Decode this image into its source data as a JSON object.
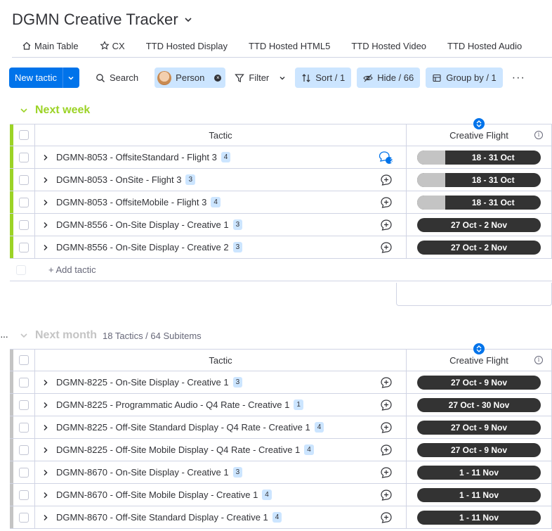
{
  "board": {
    "title": "DGMN Creative Tracker"
  },
  "views": [
    {
      "label": "Main Table",
      "icon": "home-icon"
    },
    {
      "label": "CX",
      "icon": "star-icon"
    },
    {
      "label": "TTD Hosted Display",
      "icon": ""
    },
    {
      "label": "TTD Hosted HTML5",
      "icon": ""
    },
    {
      "label": "TTD Hosted Video",
      "icon": ""
    },
    {
      "label": "TTD Hosted Audio",
      "icon": ""
    }
  ],
  "toolbar": {
    "new_label": "New tactic",
    "search_label": "Search",
    "person_label": "Person",
    "filter_label": "Filter",
    "sort_label": "Sort / 1",
    "hide_label": "Hide / 66",
    "group_label": "Group by / 1"
  },
  "colors": {
    "next_week": "#9cd326",
    "next_month": "#c4c4c4",
    "accent": "#0073ea",
    "timeline_dark": "#333333",
    "timeline_past": "#c4c4c4"
  },
  "columns": {
    "tactic": "Tactic",
    "flight": "Creative Flight"
  },
  "groups": [
    {
      "name": "Next week",
      "count": "",
      "rows": [
        {
          "name": "DGMN-8053 - OffsiteStandard - Flight 3",
          "badge": "4",
          "updates": "2",
          "flight": "18 - 31 Oct",
          "progress": 0.23
        },
        {
          "name": "DGMN-8053 - OnSite - Flight 3",
          "badge": "3",
          "updates": "",
          "flight": "18 - 31 Oct",
          "progress": 0.23
        },
        {
          "name": "DGMN-8053 - OffsiteMobile - Flight 3",
          "badge": "4",
          "updates": "",
          "flight": "18 - 31 Oct",
          "progress": 0.23
        },
        {
          "name": "DGMN-8556 - On-Site Display - Creative 1",
          "badge": "3",
          "updates": "",
          "flight": "27 Oct - 2 Nov",
          "progress": 0
        },
        {
          "name": "DGMN-8556 - On-Site Display - Creative 2",
          "badge": "3",
          "updates": "",
          "flight": "27 Oct - 2 Nov",
          "progress": 0
        }
      ],
      "add_label": "+ Add tactic"
    },
    {
      "name": "Next month",
      "count": "18 Tactics / 64 Subitems",
      "rows": [
        {
          "name": "DGMN-8225 - On-Site Display - Creative 1",
          "badge": "3",
          "updates": "",
          "flight": "27 Oct - 9 Nov",
          "progress": 0
        },
        {
          "name": "DGMN-8225 - Programmatic Audio - Q4 Rate - Creative 1",
          "badge": "1",
          "updates": "",
          "flight": "27 Oct - 30 Nov",
          "progress": 0
        },
        {
          "name": "DGMN-8225 - Off-Site Standard Display - Q4 Rate - Creative 1",
          "badge": "4",
          "updates": "",
          "flight": "27 Oct - 9 Nov",
          "progress": 0
        },
        {
          "name": "DGMN-8225 - Off-Site Mobile Display - Q4 Rate - Creative 1",
          "badge": "4",
          "updates": "",
          "flight": "27 Oct - 9 Nov",
          "progress": 0
        },
        {
          "name": "DGMN-8670 - On-Site Display - Creative 1",
          "badge": "3",
          "updates": "",
          "flight": "1 - 11 Nov",
          "progress": 0
        },
        {
          "name": "DGMN-8670 - Off-Site Mobile Display - Creative 1",
          "badge": "4",
          "updates": "",
          "flight": "1 - 11 Nov",
          "progress": 0
        },
        {
          "name": "DGMN-8670 - Off-Site Standard Display - Creative 1",
          "badge": "4",
          "updates": "",
          "flight": "1 - 11 Nov",
          "progress": 0
        }
      ]
    }
  ]
}
